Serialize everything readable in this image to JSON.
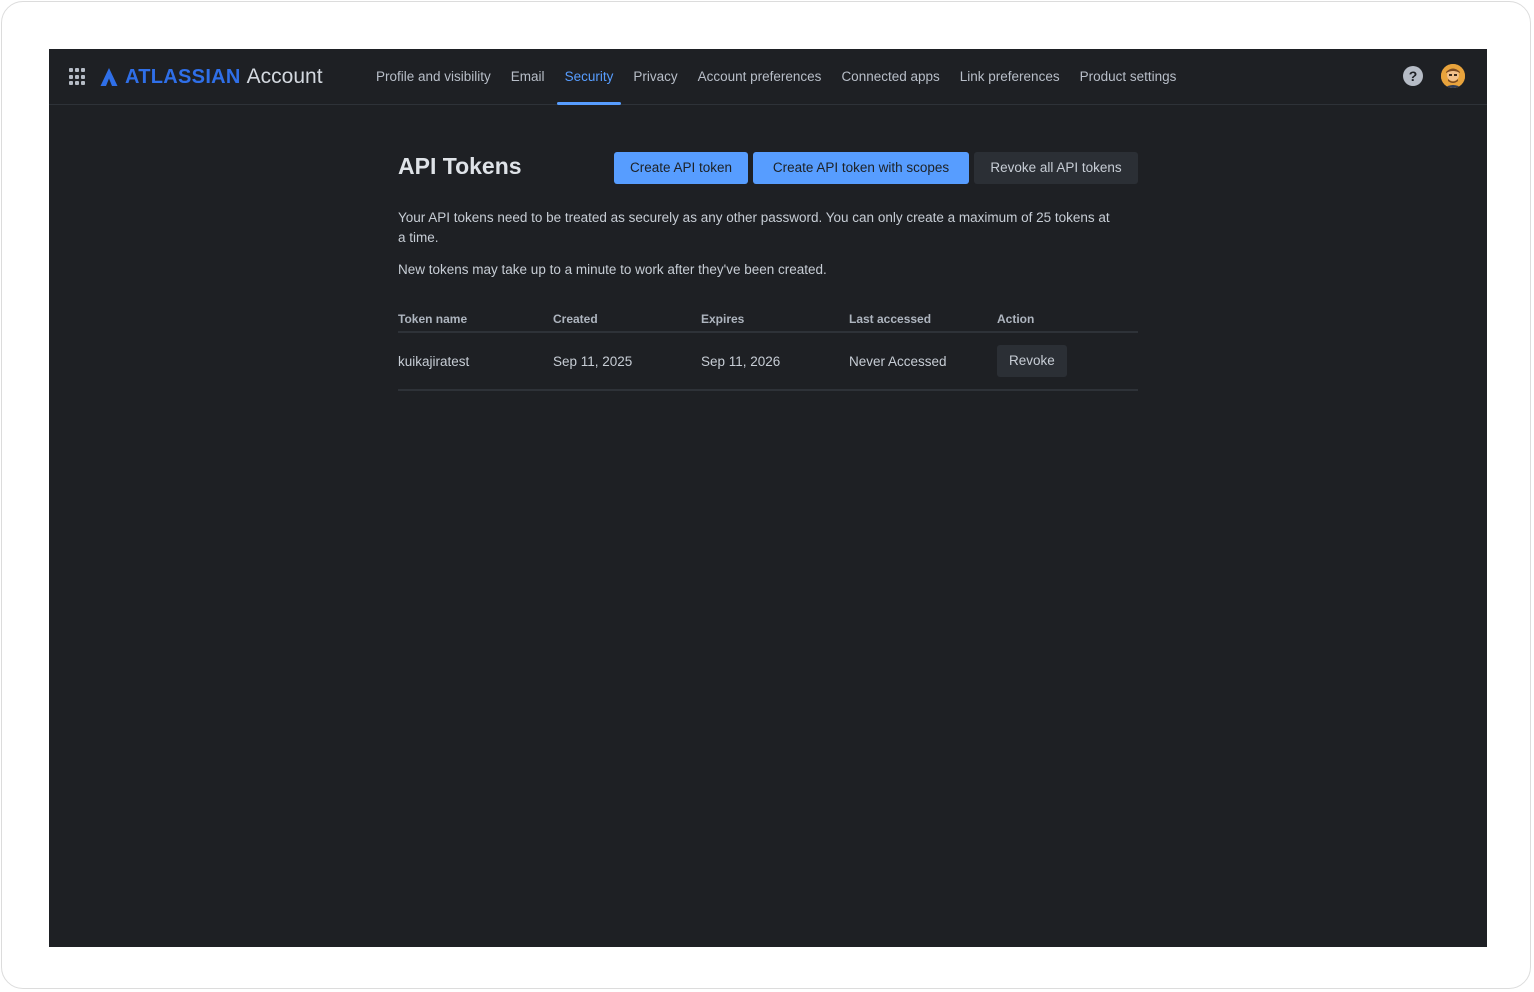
{
  "header": {
    "brand_name": "ATLASSIAN",
    "product_name": "Account",
    "nav": [
      {
        "label": "Profile and visibility",
        "active": false
      },
      {
        "label": "Email",
        "active": false
      },
      {
        "label": "Security",
        "active": true
      },
      {
        "label": "Privacy",
        "active": false
      },
      {
        "label": "Account preferences",
        "active": false
      },
      {
        "label": "Connected apps",
        "active": false
      },
      {
        "label": "Link preferences",
        "active": false
      },
      {
        "label": "Product settings",
        "active": false
      }
    ],
    "help_icon_glyph": "?",
    "icons": [
      "app-switcher-icon",
      "atlassian-logo-icon",
      "help-icon",
      "avatar"
    ]
  },
  "main": {
    "title": "API Tokens",
    "buttons": {
      "create": "Create API token",
      "create_scopes": "Create API token with scopes",
      "revoke_all": "Revoke all API tokens"
    },
    "description": "Your API tokens need to be treated as securely as any other password. You can only create a maximum of 25 tokens at a time.",
    "note": "New tokens may take up to a minute to work after they've been created.",
    "table": {
      "columns": [
        "Token name",
        "Created",
        "Expires",
        "Last accessed",
        "Action"
      ],
      "rows": [
        {
          "name": "kuikajiratest",
          "created": "Sep 11, 2025",
          "expires": "Sep 11, 2026",
          "last_accessed": "Never Accessed",
          "action": "Revoke"
        }
      ]
    }
  },
  "colors": {
    "background": "#1e2024",
    "accent": "#579dff",
    "brand_blue": "#2f6fe8"
  }
}
